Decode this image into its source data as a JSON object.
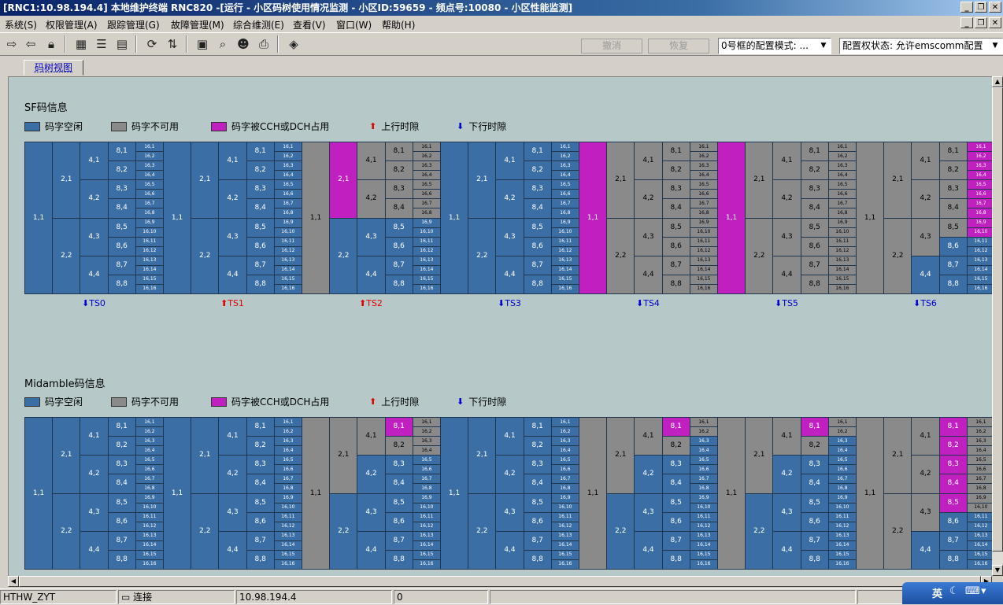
{
  "window": {
    "title": "[RNC1:10.98.194.4] 本地维护终端 RNC820 -[运行 - 小区码树使用情况监测 - 小区ID:59659 - 频点号:10080 - 小区性能监测]",
    "min": "_",
    "restore": "❐",
    "close": "✕"
  },
  "menu": [
    "系统(S)",
    "权限管理(A)",
    "跟踪管理(G)",
    "故障管理(M)",
    "综合维测(E)",
    "查看(V)",
    "窗口(W)",
    "帮助(H)"
  ],
  "toolbar": {
    "icons": [
      "login-icon",
      "logout-icon",
      "lock-icon",
      "calendar-icon",
      "list-icon",
      "table-icon",
      "refresh-icon",
      "network-icon",
      "note-icon",
      "search-icon",
      "user-icon",
      "print-icon",
      "book-icon"
    ],
    "undo": "撤消",
    "redo": "恢复",
    "mode_combo": "0号框的配置模式: ...",
    "auth_combo": "配置权状态: 允许emscomm配置"
  },
  "tab": {
    "label": "码树视图"
  },
  "legend": {
    "free": "码字空闲",
    "unavailable": "码字不可用",
    "cch": "码字被CCH或DCH占用",
    "uplink": "上行时隙",
    "downlink": "下行时隙"
  },
  "colors": {
    "free": "#3a6ea5",
    "unavailable": "#8a8a8a",
    "cch": "#c020c0",
    "up": "#e00000",
    "down": "#0000cc"
  },
  "sf": {
    "title": "SF码信息",
    "timeslots": [
      {
        "name": "TS0",
        "dir": "down"
      },
      {
        "name": "TS1",
        "dir": "up"
      },
      {
        "name": "TS2",
        "dir": "up"
      },
      {
        "name": "TS3",
        "dir": "down"
      },
      {
        "name": "TS4",
        "dir": "down"
      },
      {
        "name": "TS5",
        "dir": "down"
      },
      {
        "name": "TS6",
        "dir": "down"
      }
    ],
    "codes": {
      "TS0": {},
      "TS1": {},
      "TS2": {
        "1,1": "na",
        "2,1": "cch",
        "4,1": "na",
        "4,2": "na",
        "8,1": "na",
        "8,2": "na",
        "8,3": "na",
        "8,4": "na",
        "16,1": "na",
        "16,2": "na",
        "16,3": "na",
        "16,4": "na",
        "16,5": "na",
        "16,6": "na",
        "16,7": "na",
        "16,8": "na"
      },
      "TS3": {},
      "TS4": {
        "1,1": "cch",
        "2,1": "na",
        "2,2": "na",
        "4,1": "na",
        "4,2": "na",
        "4,3": "na",
        "4,4": "na",
        "8,1": "na",
        "8,2": "na",
        "8,3": "na",
        "8,4": "na",
        "8,5": "na",
        "8,6": "na",
        "8,7": "na",
        "8,8": "na",
        "16,1": "na",
        "16,2": "na",
        "16,3": "na",
        "16,4": "na",
        "16,5": "na",
        "16,6": "na",
        "16,7": "na",
        "16,8": "na",
        "16,9": "na",
        "16,10": "na",
        "16,11": "na",
        "16,12": "na",
        "16,13": "na",
        "16,14": "na",
        "16,15": "na",
        "16,16": "na"
      },
      "TS5": {
        "1,1": "cch",
        "2,1": "na",
        "2,2": "na",
        "4,1": "na",
        "4,2": "na",
        "4,3": "na",
        "4,4": "na",
        "8,1": "na",
        "8,2": "na",
        "8,3": "na",
        "8,4": "na",
        "8,5": "na",
        "8,6": "na",
        "8,7": "na",
        "8,8": "na",
        "16,1": "na",
        "16,2": "na",
        "16,3": "na",
        "16,4": "na",
        "16,5": "na",
        "16,6": "na",
        "16,7": "na",
        "16,8": "na",
        "16,9": "na",
        "16,10": "na",
        "16,11": "na",
        "16,12": "na",
        "16,13": "na",
        "16,14": "na",
        "16,15": "na",
        "16,16": "na"
      },
      "TS6": {
        "1,1": "na",
        "2,1": "na",
        "2,2": "na",
        "4,1": "na",
        "4,2": "na",
        "4,3": "na",
        "8,1": "na",
        "8,2": "na",
        "8,3": "na",
        "8,4": "na",
        "8,5": "na",
        "16,1": "cch",
        "16,2": "cch",
        "16,3": "cch",
        "16,4": "cch",
        "16,5": "cch",
        "16,6": "cch",
        "16,7": "cch",
        "16,8": "cch",
        "16,9": "cch",
        "16,10": "cch"
      }
    }
  },
  "midamble": {
    "title": "Midamble码信息",
    "timeslots": [
      {
        "name": "TS0",
        "dir": "down"
      },
      {
        "name": "TS1",
        "dir": "up"
      },
      {
        "name": "TS2",
        "dir": "up"
      },
      {
        "name": "TS3",
        "dir": "down"
      },
      {
        "name": "TS4",
        "dir": "down"
      },
      {
        "name": "TS5",
        "dir": "down"
      },
      {
        "name": "TS6",
        "dir": "down"
      }
    ],
    "codes": {
      "TS0": {},
      "TS1": {},
      "TS2": {
        "1,1": "na",
        "2,1": "na",
        "4,1": "na",
        "8,1": "cch",
        "8,2": "na",
        "16,1": "na",
        "16,2": "na",
        "16,3": "na",
        "16,4": "na"
      },
      "TS3": {},
      "TS4": {
        "1,1": "na",
        "2,1": "na",
        "4,1": "na",
        "8,1": "cch",
        "8,2": "na",
        "16,1": "na",
        "16,2": "na"
      },
      "TS5": {
        "1,1": "na",
        "2,1": "na",
        "4,1": "na",
        "8,1": "cch",
        "8,2": "na",
        "16,1": "na",
        "16,2": "na"
      },
      "TS6": {
        "1,1": "na",
        "2,1": "na",
        "2,2": "na",
        "4,1": "na",
        "4,2": "na",
        "4,3": "na",
        "8,1": "cch",
        "8,2": "cch",
        "8,3": "cch",
        "8,4": "cch",
        "8,5": "cch",
        "16,1": "na",
        "16,2": "na",
        "16,3": "na",
        "16,4": "na",
        "16,5": "na",
        "16,6": "na",
        "16,7": "na",
        "16,8": "na",
        "16,9": "na",
        "16,10": "na"
      }
    }
  },
  "status": {
    "user": "HTHW_ZYT",
    "conn": "连接",
    "ip": "10.98.194.4",
    "count": "0",
    "ime": "英"
  }
}
